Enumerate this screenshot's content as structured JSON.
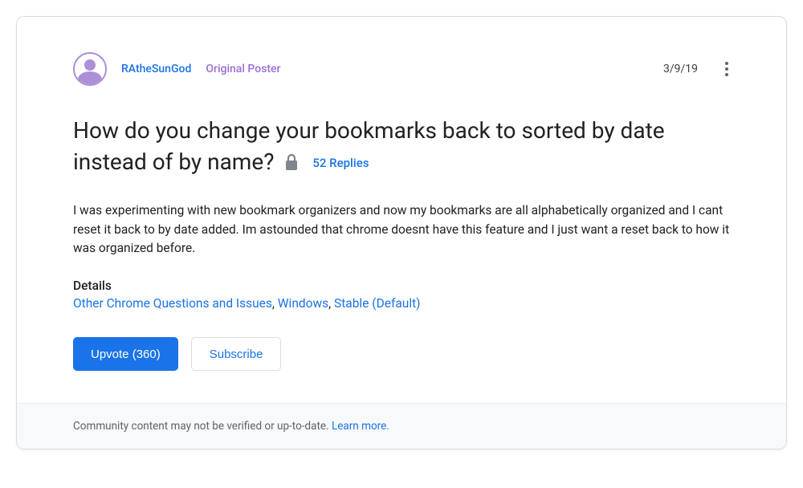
{
  "post": {
    "author": "RAtheSunGod",
    "badge": "Original Poster",
    "date": "3/9/19",
    "title": "How do you change your bookmarks back to sorted by date instead of by name?",
    "replies": "52 Replies",
    "body": "I was experimenting with new bookmark organizers and now my bookmarks are all alphabetically organized and I cant reset it back to by date added. Im astounded that chrome doesnt have this feature and I just want a reset back to how it was organized before.",
    "details_label": "Details",
    "details": {
      "category": "Other Chrome Questions and Issues",
      "platform": "Windows",
      "channel": "Stable (Default)"
    }
  },
  "actions": {
    "upvote_label": "Upvote (360)",
    "subscribe_label": "Subscribe"
  },
  "footer": {
    "notice": "Community content may not be verified or up-to-date. ",
    "learn_more": "Learn more."
  }
}
